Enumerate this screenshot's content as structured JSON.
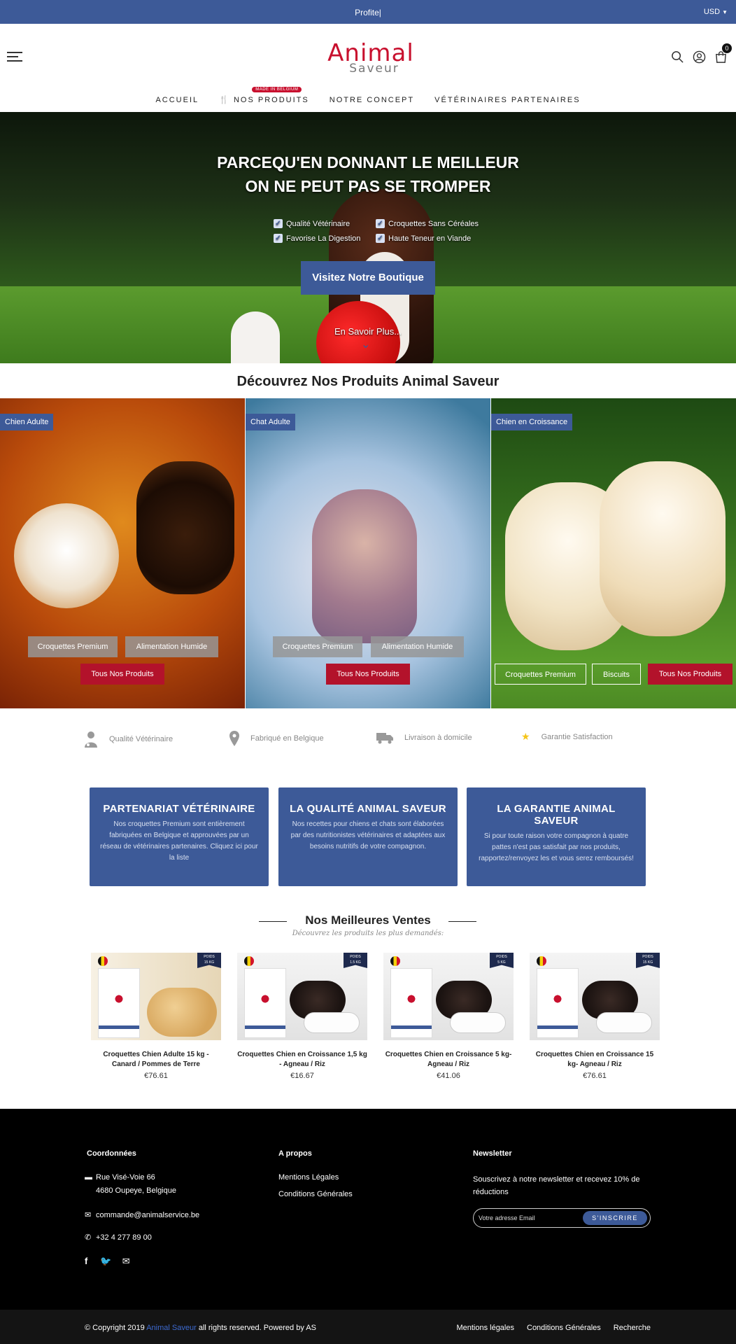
{
  "topbar": {
    "promo": "Profite|",
    "currency": "USD"
  },
  "header": {
    "logo_line1": "Animal",
    "logo_line2": "Saveur",
    "cart_count": "0",
    "nav": [
      {
        "label": "ACCUEIL"
      },
      {
        "label": "NOS PRODUITS",
        "badge": "MADE IN BELGIUM",
        "icon": "food-icon"
      },
      {
        "label": "NOTRE CONCEPT"
      },
      {
        "label": "VÉTÉRINAIRES PARTENAIRES"
      }
    ]
  },
  "hero": {
    "title_line1": "PARCEQU'EN DONNANT LE MEILLEUR",
    "title_line2": "ON NE PEUT PAS SE TROMPER",
    "checks": [
      "Qualité Vétérinaire",
      "Croquettes Sans Céréales",
      "Favorise La Digestion",
      "Haute Teneur en Viande"
    ],
    "cta": "Visitez Notre Boutique",
    "more": "En Savoir Plus..."
  },
  "products_section": {
    "title": "Découvrez Nos Produits Animal Saveur"
  },
  "categories": [
    {
      "tag": "Chien Adulte",
      "pills": [
        "Croquettes Premium",
        "Alimentation Humide"
      ],
      "cta": "Tous Nos Produits"
    },
    {
      "tag": "Chat Adulte",
      "pills": [
        "Croquettes Premium",
        "Alimentation Humide"
      ],
      "cta": "Tous Nos Produits"
    },
    {
      "tag": "Chien en Croissance",
      "pills": [
        "Croquettes Premium",
        "Biscuits"
      ],
      "cta": "Tous Nos Produits"
    }
  ],
  "features": [
    "Qualité Vétérinaire",
    "Fabriqué en Belgique",
    "Livraison à domicile",
    "Garantie Satisfaction"
  ],
  "infoboxes": [
    {
      "title": "PARTENARIAT VÉTÉRINAIRE",
      "text": "Nos croquettes Premium sont entièrement fabriquées en Belgique et approuvées par un réseau de vétérinaires partenaires. Cliquez ici pour la liste"
    },
    {
      "title": "LA QUALITÉ ANIMAL SAVEUR",
      "text": "Nos recettes pour chiens et chats sont élaborées par des nutritionistes vétérinaires et adaptées aux besoins nutritifs de votre compagnon."
    },
    {
      "title": "LA GARANTIE ANIMAL SAVEUR",
      "text": "Si pour toute raison votre compagnon à quatre pattes n'est pas satisfait par nos produits, rapportez/renvoyez les et vous serez remboursés!"
    }
  ],
  "bestsellers": {
    "title": "Nos Meilleures Ventes",
    "subtitle": "Découvrez les produits les plus demandés:",
    "products": [
      {
        "name": "Croquettes Chien Adulte 15 kg - Canard / Pommes de Terre",
        "price": "€76.61",
        "badge_top": "POIDS",
        "badge_weight": "15 KG"
      },
      {
        "name": "Croquettes Chien en Croissance 1,5 kg - Agneau / Riz",
        "price": "€16.67",
        "badge_top": "POIDS",
        "badge_weight": "1.5 KG"
      },
      {
        "name": "Croquettes Chien en Croissance 5 kg- Agneau / Riz",
        "price": "€41.06",
        "badge_top": "POIDS",
        "badge_weight": "5 KG"
      },
      {
        "name": "Croquettes Chien en Croissance 15 kg- Agneau / Riz",
        "price": "€76.61",
        "badge_top": "POIDS",
        "badge_weight": "15 KG"
      }
    ]
  },
  "footer": {
    "col1_title": "Coordonnées",
    "address_line1": "Rue Visé-Voie 66",
    "address_line2": "4680 Oupeye, Belgique",
    "email": "commande@animalservice.be",
    "phone": "+32 4 277 89 00",
    "col2_title": "A propos",
    "links": [
      "Mentions Légales",
      "Conditions Générales"
    ],
    "col3_title": "Newsletter",
    "newsletter_text": "Souscrivez à notre newsletter et recevez 10% de réductions",
    "newsletter_placeholder": "Votre adresse Email",
    "newsletter_button": "S'INSCRIRE"
  },
  "bottombar": {
    "copy_prefix": "© Copyright 2019",
    "brand": "Animal Saveur",
    "copy_suffix": "all rights reserved. Powered by AS",
    "links": [
      "Mentions légales",
      "Conditions Générales",
      "Recherche"
    ]
  },
  "colors": {
    "brand_blue": "#3d5a98",
    "brand_red": "#c8102e",
    "cta_red": "#b3122b"
  }
}
